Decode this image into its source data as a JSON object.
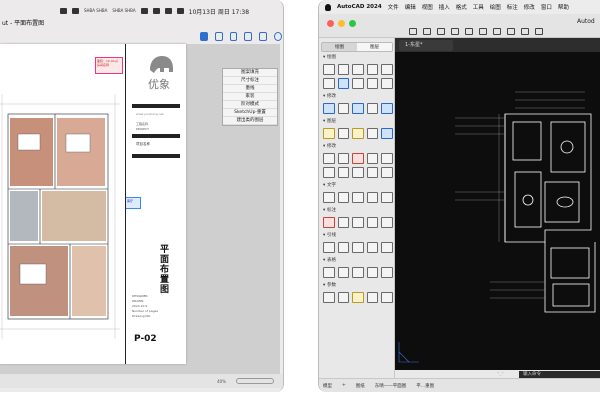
{
  "system": {
    "date_time": "10月13日 周日 17:38",
    "tray_tiny_1": "SHBA SHBA",
    "tray_tiny_2": "SHBA SHBA"
  },
  "pdf_viewer": {
    "window_title": "ut - 平面布置图",
    "toolbar_icons": [
      "page-icon",
      "doc-icon",
      "doc-icon",
      "doc-icon",
      "doc-icon",
      "circle-icon"
    ],
    "layer_menu": [
      "图案填充",
      "尺寸标注",
      "墨线",
      "家装",
      "阶对模式",
      "SketchUp·重置",
      "建出类的图层"
    ],
    "title_block": {
      "logo_text": "优象",
      "url": "www.youxiang.net",
      "line1": "工程名称",
      "line2": "PROJECT",
      "client": "项目名称",
      "drawing_title": "平面布置图",
      "meta": [
        "DESIGNER",
        "DRAWN",
        "2024.10.9",
        "Number of pages",
        "Drawing NO."
      ],
      "page_no": "P-02"
    },
    "leader_note": "面积：12.00㎡ 房间名称",
    "blue_note": "客厅",
    "status": {
      "zoom": "40%"
    }
  },
  "autocad": {
    "menu": [
      "AutoCAD 2024",
      "文件",
      "编辑",
      "视图",
      "插入",
      "格式",
      "工具",
      "绘图",
      "标注",
      "修改",
      "窗口",
      "帮助"
    ],
    "window_title": "Autod",
    "doc_tab": "1-东星*",
    "sidebar_tabs": [
      "绘图",
      "图层"
    ],
    "sidebar_sections": [
      "绘图",
      "修改",
      "图层",
      "修改",
      "文字",
      "标注",
      "引线",
      "表格",
      "参数"
    ],
    "command_prefix": "*_*",
    "command_placeholder": "输入命令",
    "status_tabs": [
      "模型",
      "+",
      "图纸",
      "东晴——平面图",
      "平...重图"
    ]
  },
  "colors": {
    "accent": "#2c6fcf",
    "cad_bg": "#0d0d0d",
    "cad_line": "#ffffff",
    "cad_dim": "#b7b7b7"
  }
}
